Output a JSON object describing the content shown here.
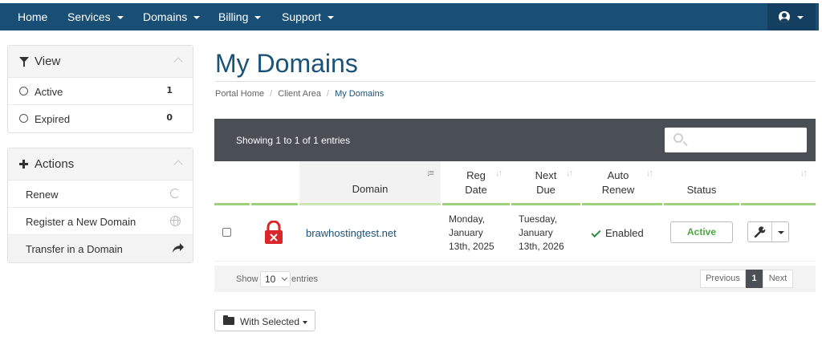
{
  "nav": {
    "items": [
      {
        "label": "Home",
        "dropdown": false
      },
      {
        "label": "Services",
        "dropdown": true
      },
      {
        "label": "Domains",
        "dropdown": true
      },
      {
        "label": "Billing",
        "dropdown": true
      },
      {
        "label": "Support",
        "dropdown": true
      }
    ],
    "account_icon": "user-circle-icon"
  },
  "sidebar": {
    "view": {
      "title": "View",
      "icon": "filter-icon",
      "items": [
        {
          "label": "Active",
          "count": "1"
        },
        {
          "label": "Expired",
          "count": "0"
        }
      ]
    },
    "actions": {
      "title": "Actions",
      "icon": "plus-icon",
      "items": [
        {
          "label": "Renew",
          "icon": "refresh-icon"
        },
        {
          "label": "Register a New Domain",
          "icon": "globe-icon"
        },
        {
          "label": "Transfer in a Domain",
          "icon": "share-icon"
        }
      ]
    }
  },
  "page": {
    "title": "My Domains",
    "breadcrumb": [
      "Portal Home",
      "Client Area",
      "My Domains"
    ]
  },
  "table": {
    "info": "Showing 1 to 1 of 1 entries",
    "columns": [
      {
        "line1": "Domain",
        "line2": ""
      },
      {
        "line1": "Reg",
        "line2": "Date"
      },
      {
        "line1": "Next",
        "line2": "Due"
      },
      {
        "line1": "Auto",
        "line2": "Renew"
      },
      {
        "line1": "Status",
        "line2": ""
      }
    ],
    "rows": [
      {
        "domain": "brawhostingtest.net",
        "lock_icon": "ssl-lock-error-icon",
        "reg_date": [
          "Monday,",
          "January",
          "13th, 2025"
        ],
        "next_due": [
          "Tuesday,",
          "January",
          "13th, 2026"
        ],
        "auto_renew": "Enabled",
        "status": "Active"
      }
    ],
    "footer": {
      "show_label": "Show",
      "page_length": "10",
      "entries_label": "entries",
      "previous": "Previous",
      "current_page": "1",
      "next": "Next"
    }
  },
  "bulk": {
    "label": "With Selected"
  },
  "colors": {
    "nav_bg": "#1a4f75",
    "title": "#1b5278",
    "header_dark": "#4a4e55",
    "active_green": "#4aa93f",
    "lock_red": "#d9262b",
    "column_accent": "#9fd07c"
  }
}
